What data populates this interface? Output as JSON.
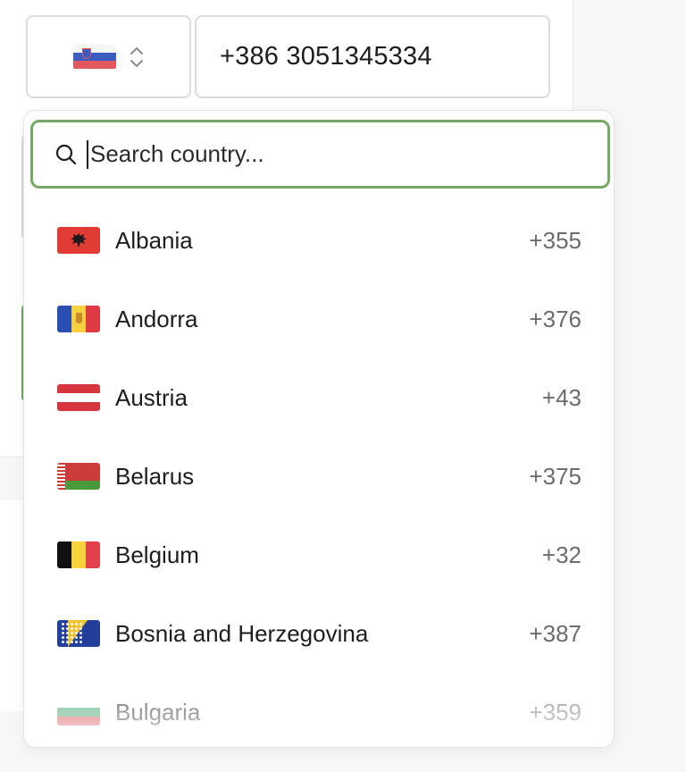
{
  "phone": {
    "selected_country_flag": "slovenia-flag",
    "number_value": "+386 3051345334"
  },
  "dropdown": {
    "search_placeholder": "Search country...",
    "colors": {
      "focus_border": "#77a86a",
      "code_text": "#6b6b70"
    },
    "countries": [
      {
        "name": "Albania",
        "code": "+355",
        "flag": "albania-flag"
      },
      {
        "name": "Andorra",
        "code": "+376",
        "flag": "andorra-flag"
      },
      {
        "name": "Austria",
        "code": "+43",
        "flag": "austria-flag"
      },
      {
        "name": "Belarus",
        "code": "+375",
        "flag": "belarus-flag"
      },
      {
        "name": "Belgium",
        "code": "+32",
        "flag": "belgium-flag"
      },
      {
        "name": "Bosnia and Herzegovina",
        "code": "+387",
        "flag": "bosnia-flag"
      },
      {
        "name": "Bulgaria",
        "code": "+359",
        "flag": "bulgaria-flag"
      }
    ]
  }
}
